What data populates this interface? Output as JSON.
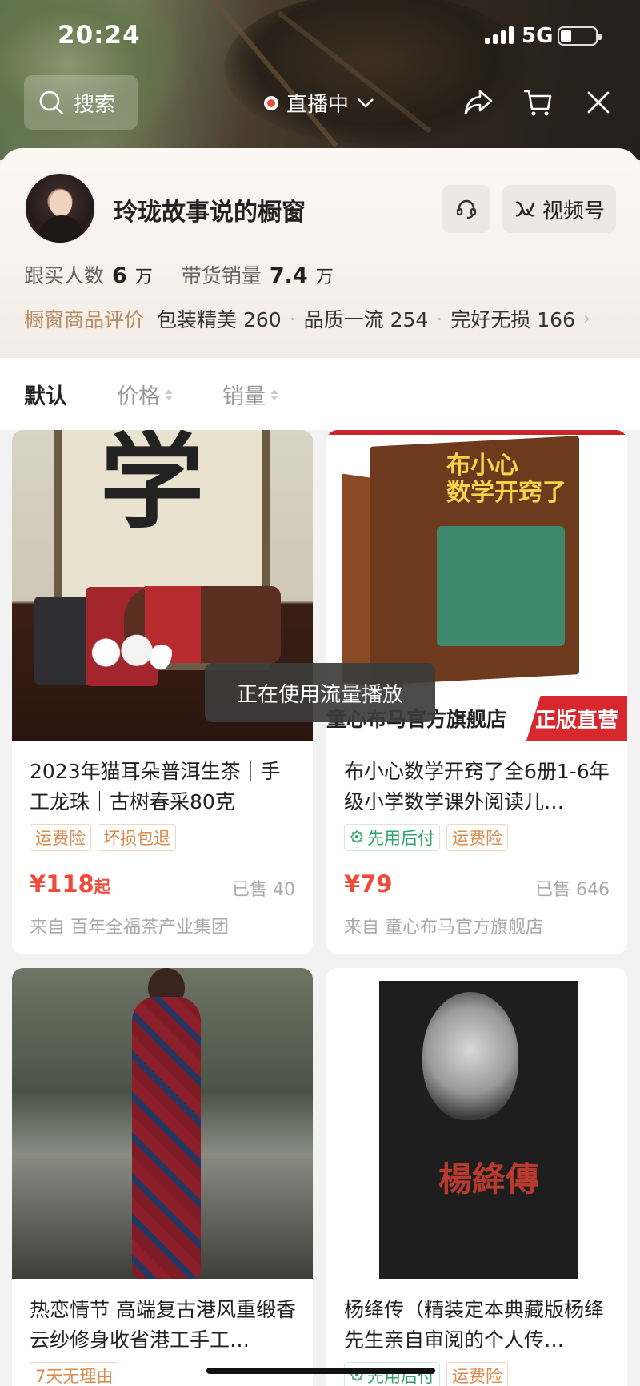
{
  "status": {
    "time": "20:24",
    "network": "5G"
  },
  "nav": {
    "search_label": "搜索",
    "live_label": "直播中"
  },
  "shop": {
    "name": "玲珑故事说的橱窗",
    "video_btn": "视频号",
    "followers_label": "跟买人数",
    "followers_value": "6",
    "followers_unit": "万",
    "sales_label": "带货销量",
    "sales_value": "7.4",
    "sales_unit": "万",
    "reviews_title": "橱窗商品评价",
    "reviews": [
      {
        "label": "包装精美",
        "count": "260"
      },
      {
        "label": "品质一流",
        "count": "254"
      },
      {
        "label": "完好无损",
        "count": "166"
      }
    ]
  },
  "sort": {
    "default": "默认",
    "price": "价格",
    "sales": "销量"
  },
  "products": [
    {
      "title": "2023年猫耳朵普洱生茶｜手工龙珠｜古树春采80克",
      "tags": [
        "运费险",
        "坏损包退"
      ],
      "price": "¥118",
      "price_suffix": "起",
      "sold": "已售 40",
      "from": "来自 百年全福茶产业集团",
      "image_text": "学"
    },
    {
      "title": "布小心数学开窍了全6册1-6年级小学数学课外阅读儿…",
      "tags": [
        "先用后付",
        "运费险"
      ],
      "price": "¥79",
      "price_suffix": "",
      "sold": "已售 646",
      "from": "来自 童心布马官方旗舰店",
      "image_text": "布小心\n数学开窍了",
      "image_banner_left": "童心布马官方旗舰店",
      "image_banner_right": "正版直营"
    },
    {
      "title": "热恋情节 高端复古港风重缎香云纱修身收省港工手工…",
      "tags": [
        "7天无理由"
      ]
    },
    {
      "title": "杨绛传（精装定本典藏版杨绛先生亲自审阅的个人传…",
      "tags": [
        "先用后付",
        "运费险"
      ],
      "image_text": "楊絳傳"
    }
  ],
  "toast": "正在使用流量播放",
  "colors": {
    "price": "#f04a3b",
    "accent_gold": "#b98c64",
    "live_dot": "#f04a3b"
  }
}
